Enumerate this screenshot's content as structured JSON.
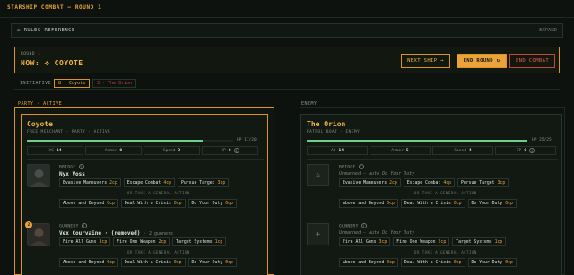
{
  "header": {
    "title": "STARSHIP COMBAT — ROUND 1"
  },
  "rules": {
    "label": "RULES REFERENCE",
    "expand": "+ EXPAND"
  },
  "round": {
    "label": "ROUND 1",
    "now": "NOW: ⟡ COYOTE",
    "next_ship": "NEXT SHIP →",
    "end_round": "END ROUND ↻",
    "end_combat": "END COMBAT"
  },
  "initiative": {
    "label": "INITIATIVE",
    "chips": [
      "8 · Coyote",
      "3 · The Orion"
    ]
  },
  "party": {
    "label": "PARTY · ACTIVE",
    "ship": {
      "name": "Coyote",
      "sub": "FREE MERCHANT · PARTY · ACTIVE",
      "hp_text": "HP 17/20",
      "hp_fraction": 0.85,
      "stats": [
        {
          "label": "AC",
          "value": "14"
        },
        {
          "label": "Armor",
          "value": "0"
        },
        {
          "label": "Speed",
          "value": "3"
        },
        {
          "label": "CP",
          "value": "0"
        }
      ],
      "roles": [
        {
          "name": "BRIDGE",
          "who": "Nyx Voss",
          "actions": [
            {
              "label": "Evasive Maneuvers",
              "cp": "2cp"
            },
            {
              "label": "Escape Combat",
              "cp": "4cp"
            },
            {
              "label": "Pursue Target",
              "cp": "3cp"
            }
          ],
          "or": "OR TAKE A GENERAL ACTION",
          "general": [
            {
              "label": "Above and Beyond",
              "cp": "0cp"
            },
            {
              "label": "Deal With a Crisis",
              "cp": "0cp"
            },
            {
              "label": "Do Your Duty",
              "cp": "0cp"
            }
          ]
        },
        {
          "name": "GUNNERY",
          "badge": "2",
          "who": "Vex Courvaine · (removed)",
          "who_extra": "· 2 gunners",
          "actions": [
            {
              "label": "Fire All Guns",
              "cp": "3cp"
            },
            {
              "label": "Fire One Weapon",
              "cp": "2cp"
            },
            {
              "label": "Target Systems",
              "cp": "1cp"
            }
          ],
          "or": "OR TAKE A GENERAL ACTION",
          "general": [
            {
              "label": "Above and Beyond",
              "cp": "0cp"
            },
            {
              "label": "Deal With a Crisis",
              "cp": "0cp"
            },
            {
              "label": "Do Your Duty",
              "cp": "0cp"
            }
          ]
        }
      ]
    }
  },
  "enemy": {
    "label": "ENEMY",
    "ship": {
      "name": "The Orion",
      "sub": "PATROL BOAT · ENEMY",
      "hp_text": "HP 25/25",
      "hp_fraction": 1.0,
      "stats": [
        {
          "label": "AC",
          "value": "14"
        },
        {
          "label": "Armor",
          "value": "5"
        },
        {
          "label": "Speed",
          "value": "4"
        },
        {
          "label": "CP",
          "value": "0"
        }
      ],
      "roles": [
        {
          "name": "BRIDGE",
          "who": "Unmanned — auto Do Your Duty",
          "actions": [
            {
              "label": "Evasive Maneuvers",
              "cp": "2cp"
            },
            {
              "label": "Escape Combat",
              "cp": "4cp"
            },
            {
              "label": "Pursue Target",
              "cp": "3cp"
            }
          ],
          "or": "OR TAKE A GENERAL ACTION",
          "general": [
            {
              "label": "Above and Beyond",
              "cp": "0cp"
            },
            {
              "label": "Deal With a Crisis",
              "cp": "0cp"
            },
            {
              "label": "Do Your Duty",
              "cp": "0cp"
            }
          ]
        },
        {
          "name": "GUNNERY",
          "who": "Unmanned — auto Do Your Duty",
          "actions": [
            {
              "label": "Fire All Guns",
              "cp": "3cp"
            },
            {
              "label": "Fire One Weapon",
              "cp": "2cp"
            },
            {
              "label": "Target Systems",
              "cp": "1cp"
            }
          ],
          "or": "OR TAKE A GENERAL ACTION",
          "general": [
            {
              "label": "Above and Beyond",
              "cp": "0cp"
            },
            {
              "label": "Deal With a Crisis",
              "cp": "0cp"
            },
            {
              "label": "Do Your Duty",
              "cp": "0cp"
            }
          ]
        }
      ]
    }
  },
  "colors": {
    "accent": "#e9a33a",
    "hp": "#6fd08a",
    "danger": "#c0473a",
    "bg": "#0d120f"
  }
}
